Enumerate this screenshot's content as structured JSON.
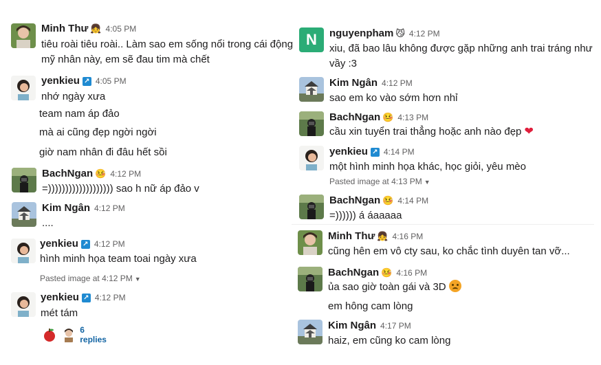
{
  "left": {
    "m1": {
      "name": "Minh Thư",
      "emoji": "👧",
      "time": "4:05 PM",
      "lines": [
        "tiêu roài tiêu roài.. Làm sao em sống nổi trong cái động",
        "mỹ nhân này, em sẽ đau tim mà chết"
      ]
    },
    "m2": {
      "name": "yenkieu",
      "emoji": "↗",
      "time": "4:05 PM",
      "text": "nhớ ngày xưa",
      "extra": [
        "team nam áp đảo",
        "mà ai cũng đẹp ngời ngời",
        "giờ nam nhân đi đâu hết sồi"
      ]
    },
    "m3": {
      "name": "BachNgan",
      "emoji": "🤒",
      "time": "4:12 PM",
      "text": "=))))))))))))))))))) sao h nữ áp đảo v"
    },
    "m4": {
      "name": "Kim Ngân",
      "time": "4:12 PM",
      "text": "...."
    },
    "m5": {
      "name": "yenkieu",
      "emoji": "↗",
      "time": "4:12 PM",
      "text": "hình minh họa team toai ngày xưa",
      "meta_prefix": "Pasted image at",
      "meta_time": "4:12 PM"
    },
    "m6": {
      "name": "yenkieu",
      "emoji": "↗",
      "time": "4:12 PM",
      "text": "mét tám",
      "replies": "6 replies"
    }
  },
  "right": {
    "m1": {
      "name": "nguyenpham",
      "emoji": "😼",
      "time": "4:12 PM",
      "avatar_letter": "N",
      "lines": [
        "xiu, đã bao lâu không được gặp những anh trai tráng như",
        "vầy :3"
      ]
    },
    "m2": {
      "name": "Kim Ngân",
      "time": "4:12 PM",
      "text": "sao em ko vào sớm hơn nhỉ"
    },
    "m3": {
      "name": "BachNgan",
      "emoji": "🤒",
      "time": "4:13 PM",
      "text": "cầu xin tuyển trai thẳng hoặc anh nào đẹp",
      "heart": "❤"
    },
    "m4": {
      "name": "yenkieu",
      "emoji": "↗",
      "time": "4:14 PM",
      "text": "một hình minh họa khác, học giỏi, yêu mèo",
      "meta_prefix": "Pasted image at",
      "meta_time": "4:13 PM"
    },
    "m5": {
      "name": "BachNgan",
      "emoji": "🤒",
      "time": "4:14 PM",
      "text": "=)))))) á áaaaaa"
    },
    "m6": {
      "name": "Minh Thư",
      "emoji": "👧",
      "time": "4:16 PM",
      "text": "cũng hên em vô cty sau, ko chắc tình duyên tan vỡ..."
    },
    "m7": {
      "name": "BachNgan",
      "emoji": "🤒",
      "time": "4:16 PM",
      "text": "ủa sao giờ toàn gái và 3D",
      "extra": "em hông cam lòng"
    },
    "m8": {
      "name": "Kim Ngân",
      "time": "4:17 PM",
      "text": "haiz, em cũng ko cam lòng"
    }
  },
  "colors": {
    "link": "#1264a3",
    "timestamp": "#616061",
    "text": "#1d1c1d",
    "nguyenpham_avatar": "#2bac76"
  }
}
